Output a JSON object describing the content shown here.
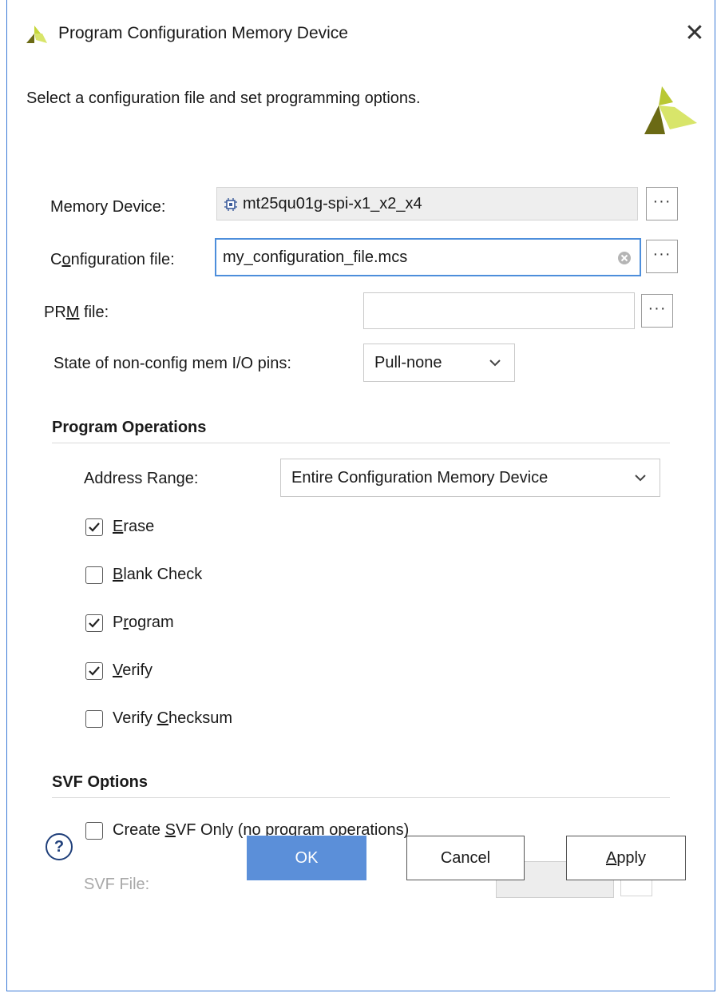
{
  "window": {
    "title": "Program Configuration Memory Device",
    "close_glyph": "✕"
  },
  "header": {
    "instruction": "Select a configuration file and set programming options."
  },
  "form": {
    "memory_device": {
      "label": "Memory Device:",
      "value": "mt25qu01g-spi-x1_x2_x4",
      "icon": "chip-icon",
      "browse": "···"
    },
    "config_file": {
      "label_pre": "C",
      "label_u": "o",
      "label_post": "nfiguration file:",
      "value": "my_configuration_file.mcs",
      "browse": "···"
    },
    "prm_file": {
      "label_pre": "PR",
      "label_u": "M",
      "label_post": " file:",
      "value": "",
      "browse": "···"
    },
    "io_pins": {
      "label": "State of non-config mem I/O pins:",
      "value": "Pull-none"
    }
  },
  "program_operations": {
    "title": "Program Operations",
    "address_range": {
      "label_pre": "Address Ran",
      "label_u": "g",
      "label_post": "e:",
      "value": "Entire Configuration Memory Device"
    },
    "options": [
      {
        "u": "E",
        "rest": "rase",
        "checked": true
      },
      {
        "u": "B",
        "rest": "lank Check",
        "checked": false
      },
      {
        "pre": "P",
        "u": "r",
        "rest": "ogram",
        "checked": true
      },
      {
        "u": "V",
        "rest": "erify",
        "checked": true
      },
      {
        "pre": "Verify ",
        "u": "C",
        "rest": "hecksum",
        "checked": false
      }
    ]
  },
  "svf_options": {
    "title": "SVF Options",
    "create_svf": {
      "pre": "Create ",
      "u": "S",
      "rest": "VF Only (no program operations)",
      "checked": false
    },
    "svf_file_label": "SVF File:",
    "svf_file_value": "",
    "browse": "···"
  },
  "buttons": {
    "help": "?",
    "ok": "OK",
    "cancel": "Cancel",
    "apply_u": "A",
    "apply_rest": "pply"
  },
  "colors": {
    "accent": "#4d8edb",
    "primary_button": "#5b8fd9",
    "logo_dark": "#6b6a14",
    "logo_light": "#d8e56a"
  }
}
